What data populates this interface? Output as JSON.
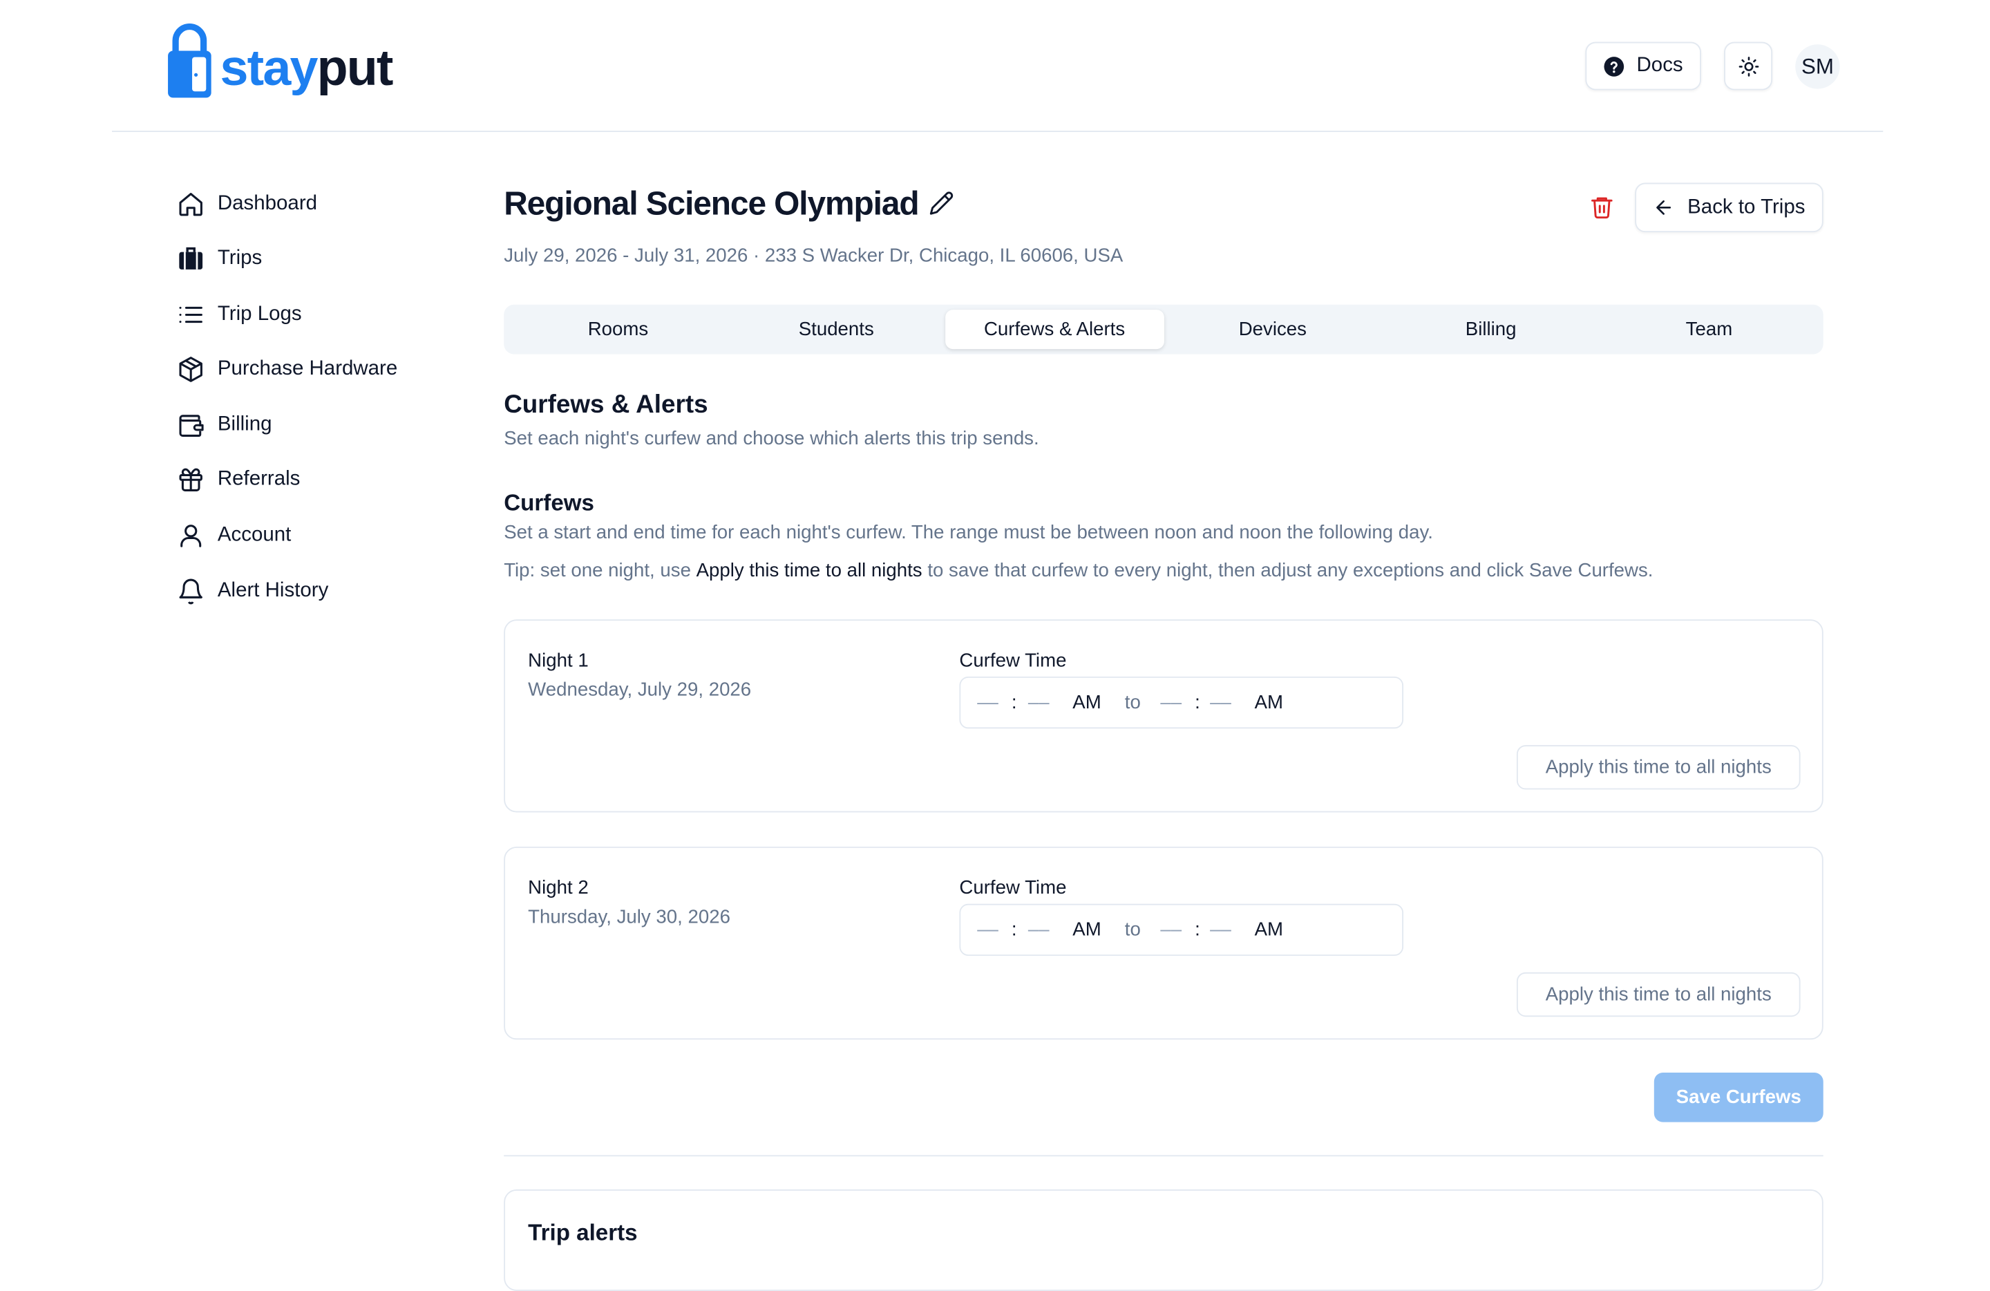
{
  "brand": {
    "name_part1": "stay",
    "name_part2": "put",
    "accent_color": "#1d7ff0"
  },
  "header": {
    "docs_label": "Docs",
    "docs_icon": "help-circle-icon",
    "theme_icon": "sun-icon",
    "avatar_initials": "SM"
  },
  "sidebar": {
    "items": [
      {
        "label": "Dashboard",
        "icon": "home-icon"
      },
      {
        "label": "Trips",
        "icon": "luggage-icon"
      },
      {
        "label": "Trip Logs",
        "icon": "list-icon"
      },
      {
        "label": "Purchase Hardware",
        "icon": "package-icon"
      },
      {
        "label": "Billing",
        "icon": "wallet-icon"
      },
      {
        "label": "Referrals",
        "icon": "gift-icon"
      },
      {
        "label": "Account",
        "icon": "user-icon"
      },
      {
        "label": "Alert History",
        "icon": "bell-icon"
      }
    ]
  },
  "trip": {
    "title": "Regional Science Olympiad",
    "subtitle": "July 29, 2026 - July 31, 2026 · 233 S Wacker Dr, Chicago, IL 60606, USA",
    "back_label": "Back to Trips",
    "delete_color": "#dc2626"
  },
  "tabs": [
    {
      "label": "Rooms",
      "active": false
    },
    {
      "label": "Students",
      "active": false
    },
    {
      "label": "Curfews & Alerts",
      "active": true
    },
    {
      "label": "Devices",
      "active": false
    },
    {
      "label": "Billing",
      "active": false
    },
    {
      "label": "Team",
      "active": false
    }
  ],
  "section": {
    "title": "Curfews & Alerts",
    "description": "Set each night's curfew and choose which alerts this trip sends."
  },
  "curfews": {
    "title": "Curfews",
    "description": "Set a start and end time for each night's curfew. The range must be between noon and noon the following day.",
    "tip_prefix": "Tip: set one night, use ",
    "tip_strong": "Apply this time to all nights",
    "tip_suffix": " to save that curfew to every night, then adjust any exceptions and click Save Curfews.",
    "time_label": "Curfew Time",
    "placeholder": "––",
    "colon": ":",
    "to": "to",
    "apply_label": "Apply this time to all nights",
    "save_label": "Save Curfews",
    "nights": [
      {
        "label": "Night 1",
        "date": "Wednesday, July 29, 2026",
        "start_ampm": "AM",
        "end_ampm": "AM"
      },
      {
        "label": "Night 2",
        "date": "Thursday, July 30, 2026",
        "start_ampm": "AM",
        "end_ampm": "AM"
      }
    ]
  },
  "alerts": {
    "title": "Trip alerts"
  }
}
